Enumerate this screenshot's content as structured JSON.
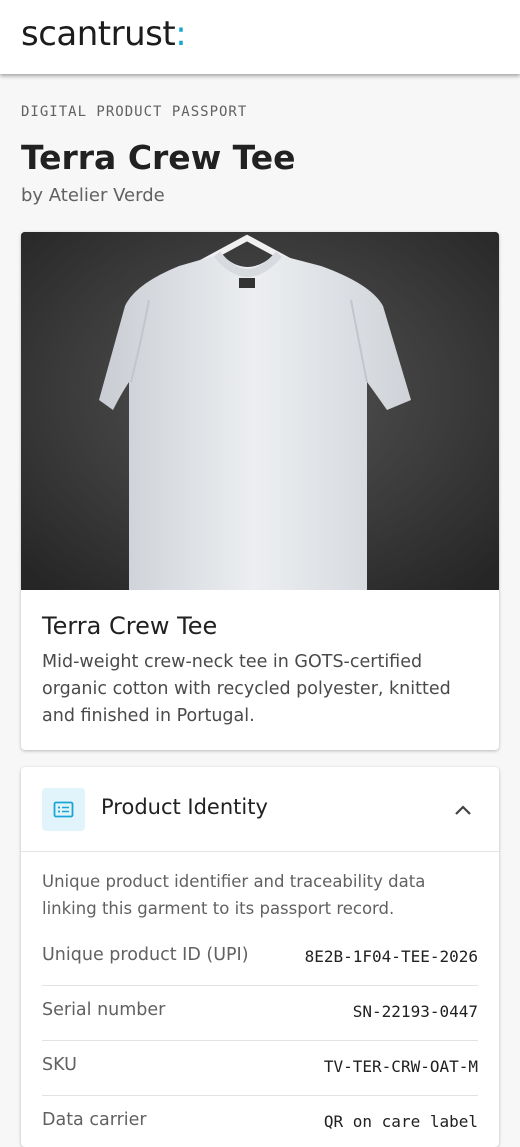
{
  "header": {
    "logo_text": "scantrust",
    "logo_colon": ":"
  },
  "page": {
    "eyebrow": "DIGITAL PRODUCT PASSPORT",
    "title": "Terra Crew Tee",
    "brand_line": "by Atelier Verde"
  },
  "product": {
    "image_icon": "t-shirt-photo",
    "name": "Terra Crew Tee",
    "description": "Mid-weight crew-neck tee in GOTS-certified organic cotton with recycled polyester, knitted and finished in Portugal."
  },
  "identity": {
    "icon": "id-card-icon",
    "title": "Product Identity",
    "expanded": true,
    "description": "Unique product identifier and traceability data linking this garment to its passport record.",
    "rows": [
      {
        "label": "Unique product ID (UPI)",
        "value": "8E2B-1F04-TEE-2026"
      },
      {
        "label": "Serial number",
        "value": "SN-22193-0447"
      },
      {
        "label": "SKU",
        "value": "TV-TER-CRW-OAT-M"
      },
      {
        "label": "Data carrier",
        "value": "QR on care label"
      }
    ]
  },
  "colors": {
    "accent": "#1aa6d4",
    "icon_bg": "#e1f4fb"
  }
}
